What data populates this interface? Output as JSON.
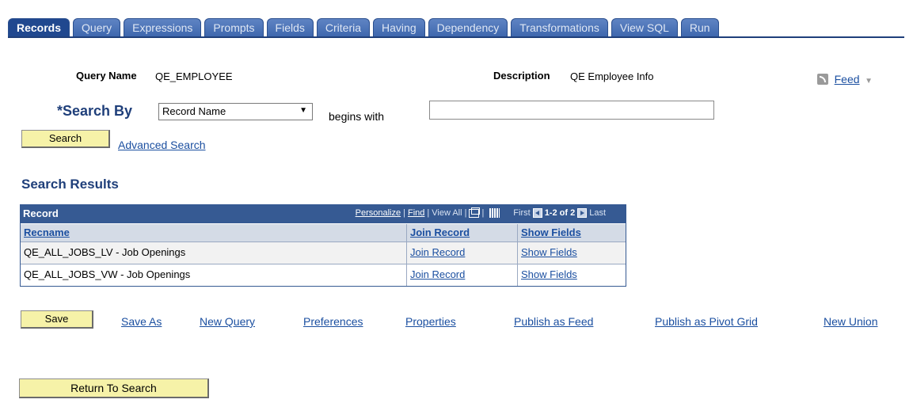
{
  "tabs": [
    "Records",
    "Query",
    "Expressions",
    "Prompts",
    "Fields",
    "Criteria",
    "Having",
    "Dependency",
    "Transformations",
    "View SQL",
    "Run"
  ],
  "query_name_label": "Query Name",
  "query_name_value": "QE_EMPLOYEE",
  "description_label": "Description",
  "description_value": "QE Employee Info",
  "feed_label": "Feed",
  "search_by_label": "*Search By",
  "search_by_value": "Record Name",
  "begins_with_label": "begins with",
  "search_input_value": "",
  "search_button": "Search",
  "advanced_search": "Advanced Search",
  "search_results_title": "Search Results",
  "grid": {
    "title": "Record",
    "personalize": "Personalize",
    "find": "Find",
    "view_all": "View All",
    "first": "First",
    "range": "1-2 of 2",
    "last": "Last",
    "columns": [
      "Recname",
      "Join Record",
      "Show Fields"
    ],
    "rows": [
      {
        "recname": "QE_ALL_JOBS_LV - Job Openings",
        "join": "Join Record",
        "show": "Show Fields"
      },
      {
        "recname": "QE_ALL_JOBS_VW - Job Openings",
        "join": "Join Record",
        "show": "Show Fields"
      }
    ]
  },
  "actions": {
    "save": "Save",
    "save_as": "Save As",
    "new_query": "New Query",
    "preferences": "Preferences",
    "properties": "Properties",
    "publish_feed": "Publish as Feed",
    "publish_pivot": "Publish as Pivot Grid",
    "new_union": "New Union"
  },
  "return_to_search": "Return To Search"
}
